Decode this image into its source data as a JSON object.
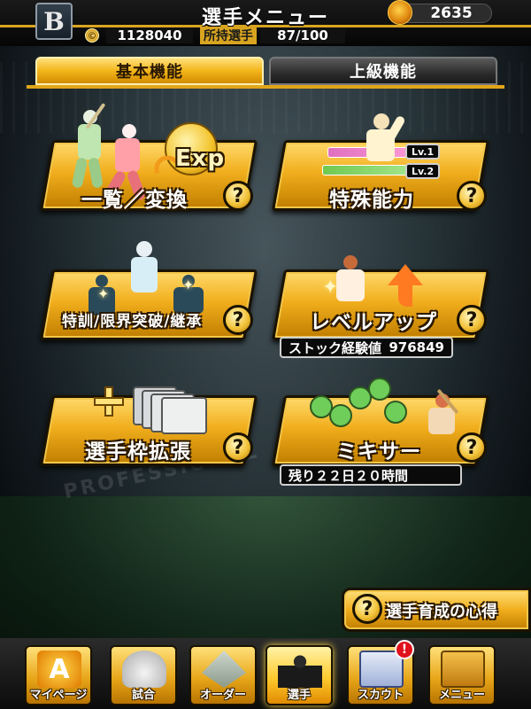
{
  "header": {
    "team_logo_letter": "B",
    "title": "選手メニュー",
    "premium_currency": "2635",
    "money_symbol": "©",
    "money": "1128040",
    "owned_players_label": "所持選手",
    "owned_players": "87/100"
  },
  "tabs": [
    {
      "label": "基本機能",
      "active": true
    },
    {
      "label": "上級機能",
      "active": false
    }
  ],
  "menu": {
    "list_exchange": {
      "label": "一覧／変換",
      "art_text": "Exp"
    },
    "special_ability": {
      "label": "特殊能力",
      "levels": [
        "Lv.1",
        "Lv.2"
      ]
    },
    "special_training": {
      "label": "特訓/限界突破/継承"
    },
    "level_up": {
      "label": "レベルアップ",
      "stock_label": "ストック経験値",
      "stock_value": "976849"
    },
    "expand_slots": {
      "label": "選手枠拡張"
    },
    "mixer": {
      "label": "ミキサー",
      "remaining": "残り２２日２０時間"
    }
  },
  "help_glyph": "?",
  "tips_button": {
    "label": "選手育成の心得"
  },
  "background": {
    "logo_text": "PROFESSIONAL"
  },
  "bottom_nav": [
    {
      "label": "マイページ",
      "icon": "a-logo-icon"
    },
    {
      "label": "試合",
      "icon": "stadium-icon"
    },
    {
      "label": "オーダー",
      "icon": "field-order-icon"
    },
    {
      "label": "選手",
      "icon": "player-icon",
      "active": true
    },
    {
      "label": "スカウト",
      "icon": "scout-card-icon",
      "badge": "!"
    },
    {
      "label": "メニュー",
      "icon": "menu-box-icon"
    }
  ],
  "colors": {
    "gold": "#f1ae1d",
    "dark": "#1a1200",
    "alert": "#e0121b"
  }
}
